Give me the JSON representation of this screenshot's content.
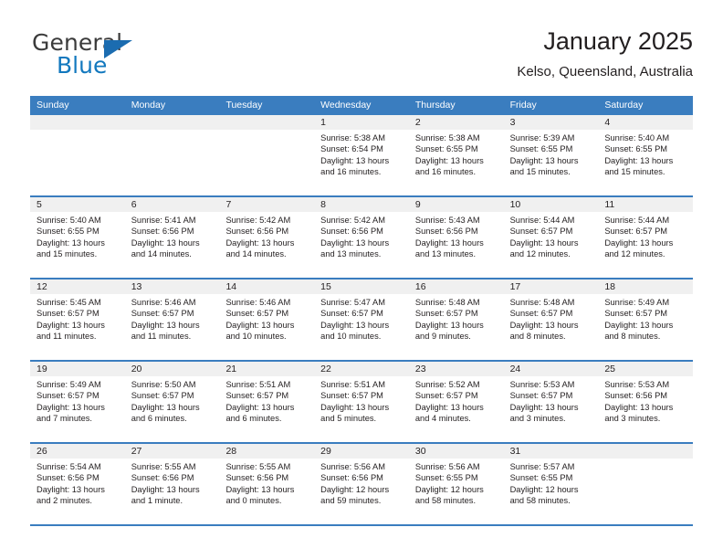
{
  "brand": {
    "word_one": "General",
    "word_two": "Blue",
    "triangle_icon": "triangle-icon",
    "color_dark": "#3b3b3b",
    "color_blue": "#1278be"
  },
  "header": {
    "title": "January 2025",
    "subtitle": "Kelso, Queensland, Australia"
  },
  "theme": {
    "header_blue": "#3a7dbf",
    "day_head_gray": "#f0f0f0",
    "text": "#231f20"
  },
  "calendar": {
    "weekdays": [
      "Sunday",
      "Monday",
      "Tuesday",
      "Wednesday",
      "Thursday",
      "Friday",
      "Saturday"
    ],
    "weeks": [
      [
        {
          "day": "",
          "sunrise": "",
          "sunset": "",
          "daylight": ""
        },
        {
          "day": "",
          "sunrise": "",
          "sunset": "",
          "daylight": ""
        },
        {
          "day": "",
          "sunrise": "",
          "sunset": "",
          "daylight": ""
        },
        {
          "day": "1",
          "sunrise": "Sunrise: 5:38 AM",
          "sunset": "Sunset: 6:54 PM",
          "daylight": "Daylight: 13 hours and 16 minutes."
        },
        {
          "day": "2",
          "sunrise": "Sunrise: 5:38 AM",
          "sunset": "Sunset: 6:55 PM",
          "daylight": "Daylight: 13 hours and 16 minutes."
        },
        {
          "day": "3",
          "sunrise": "Sunrise: 5:39 AM",
          "sunset": "Sunset: 6:55 PM",
          "daylight": "Daylight: 13 hours and 15 minutes."
        },
        {
          "day": "4",
          "sunrise": "Sunrise: 5:40 AM",
          "sunset": "Sunset: 6:55 PM",
          "daylight": "Daylight: 13 hours and 15 minutes."
        }
      ],
      [
        {
          "day": "5",
          "sunrise": "Sunrise: 5:40 AM",
          "sunset": "Sunset: 6:55 PM",
          "daylight": "Daylight: 13 hours and 15 minutes."
        },
        {
          "day": "6",
          "sunrise": "Sunrise: 5:41 AM",
          "sunset": "Sunset: 6:56 PM",
          "daylight": "Daylight: 13 hours and 14 minutes."
        },
        {
          "day": "7",
          "sunrise": "Sunrise: 5:42 AM",
          "sunset": "Sunset: 6:56 PM",
          "daylight": "Daylight: 13 hours and 14 minutes."
        },
        {
          "day": "8",
          "sunrise": "Sunrise: 5:42 AM",
          "sunset": "Sunset: 6:56 PM",
          "daylight": "Daylight: 13 hours and 13 minutes."
        },
        {
          "day": "9",
          "sunrise": "Sunrise: 5:43 AM",
          "sunset": "Sunset: 6:56 PM",
          "daylight": "Daylight: 13 hours and 13 minutes."
        },
        {
          "day": "10",
          "sunrise": "Sunrise: 5:44 AM",
          "sunset": "Sunset: 6:57 PM",
          "daylight": "Daylight: 13 hours and 12 minutes."
        },
        {
          "day": "11",
          "sunrise": "Sunrise: 5:44 AM",
          "sunset": "Sunset: 6:57 PM",
          "daylight": "Daylight: 13 hours and 12 minutes."
        }
      ],
      [
        {
          "day": "12",
          "sunrise": "Sunrise: 5:45 AM",
          "sunset": "Sunset: 6:57 PM",
          "daylight": "Daylight: 13 hours and 11 minutes."
        },
        {
          "day": "13",
          "sunrise": "Sunrise: 5:46 AM",
          "sunset": "Sunset: 6:57 PM",
          "daylight": "Daylight: 13 hours and 11 minutes."
        },
        {
          "day": "14",
          "sunrise": "Sunrise: 5:46 AM",
          "sunset": "Sunset: 6:57 PM",
          "daylight": "Daylight: 13 hours and 10 minutes."
        },
        {
          "day": "15",
          "sunrise": "Sunrise: 5:47 AM",
          "sunset": "Sunset: 6:57 PM",
          "daylight": "Daylight: 13 hours and 10 minutes."
        },
        {
          "day": "16",
          "sunrise": "Sunrise: 5:48 AM",
          "sunset": "Sunset: 6:57 PM",
          "daylight": "Daylight: 13 hours and 9 minutes."
        },
        {
          "day": "17",
          "sunrise": "Sunrise: 5:48 AM",
          "sunset": "Sunset: 6:57 PM",
          "daylight": "Daylight: 13 hours and 8 minutes."
        },
        {
          "day": "18",
          "sunrise": "Sunrise: 5:49 AM",
          "sunset": "Sunset: 6:57 PM",
          "daylight": "Daylight: 13 hours and 8 minutes."
        }
      ],
      [
        {
          "day": "19",
          "sunrise": "Sunrise: 5:49 AM",
          "sunset": "Sunset: 6:57 PM",
          "daylight": "Daylight: 13 hours and 7 minutes."
        },
        {
          "day": "20",
          "sunrise": "Sunrise: 5:50 AM",
          "sunset": "Sunset: 6:57 PM",
          "daylight": "Daylight: 13 hours and 6 minutes."
        },
        {
          "day": "21",
          "sunrise": "Sunrise: 5:51 AM",
          "sunset": "Sunset: 6:57 PM",
          "daylight": "Daylight: 13 hours and 6 minutes."
        },
        {
          "day": "22",
          "sunrise": "Sunrise: 5:51 AM",
          "sunset": "Sunset: 6:57 PM",
          "daylight": "Daylight: 13 hours and 5 minutes."
        },
        {
          "day": "23",
          "sunrise": "Sunrise: 5:52 AM",
          "sunset": "Sunset: 6:57 PM",
          "daylight": "Daylight: 13 hours and 4 minutes."
        },
        {
          "day": "24",
          "sunrise": "Sunrise: 5:53 AM",
          "sunset": "Sunset: 6:57 PM",
          "daylight": "Daylight: 13 hours and 3 minutes."
        },
        {
          "day": "25",
          "sunrise": "Sunrise: 5:53 AM",
          "sunset": "Sunset: 6:56 PM",
          "daylight": "Daylight: 13 hours and 3 minutes."
        }
      ],
      [
        {
          "day": "26",
          "sunrise": "Sunrise: 5:54 AM",
          "sunset": "Sunset: 6:56 PM",
          "daylight": "Daylight: 13 hours and 2 minutes."
        },
        {
          "day": "27",
          "sunrise": "Sunrise: 5:55 AM",
          "sunset": "Sunset: 6:56 PM",
          "daylight": "Daylight: 13 hours and 1 minute."
        },
        {
          "day": "28",
          "sunrise": "Sunrise: 5:55 AM",
          "sunset": "Sunset: 6:56 PM",
          "daylight": "Daylight: 13 hours and 0 minutes."
        },
        {
          "day": "29",
          "sunrise": "Sunrise: 5:56 AM",
          "sunset": "Sunset: 6:56 PM",
          "daylight": "Daylight: 12 hours and 59 minutes."
        },
        {
          "day": "30",
          "sunrise": "Sunrise: 5:56 AM",
          "sunset": "Sunset: 6:55 PM",
          "daylight": "Daylight: 12 hours and 58 minutes."
        },
        {
          "day": "31",
          "sunrise": "Sunrise: 5:57 AM",
          "sunset": "Sunset: 6:55 PM",
          "daylight": "Daylight: 12 hours and 58 minutes."
        },
        {
          "day": "",
          "sunrise": "",
          "sunset": "",
          "daylight": ""
        }
      ]
    ]
  }
}
